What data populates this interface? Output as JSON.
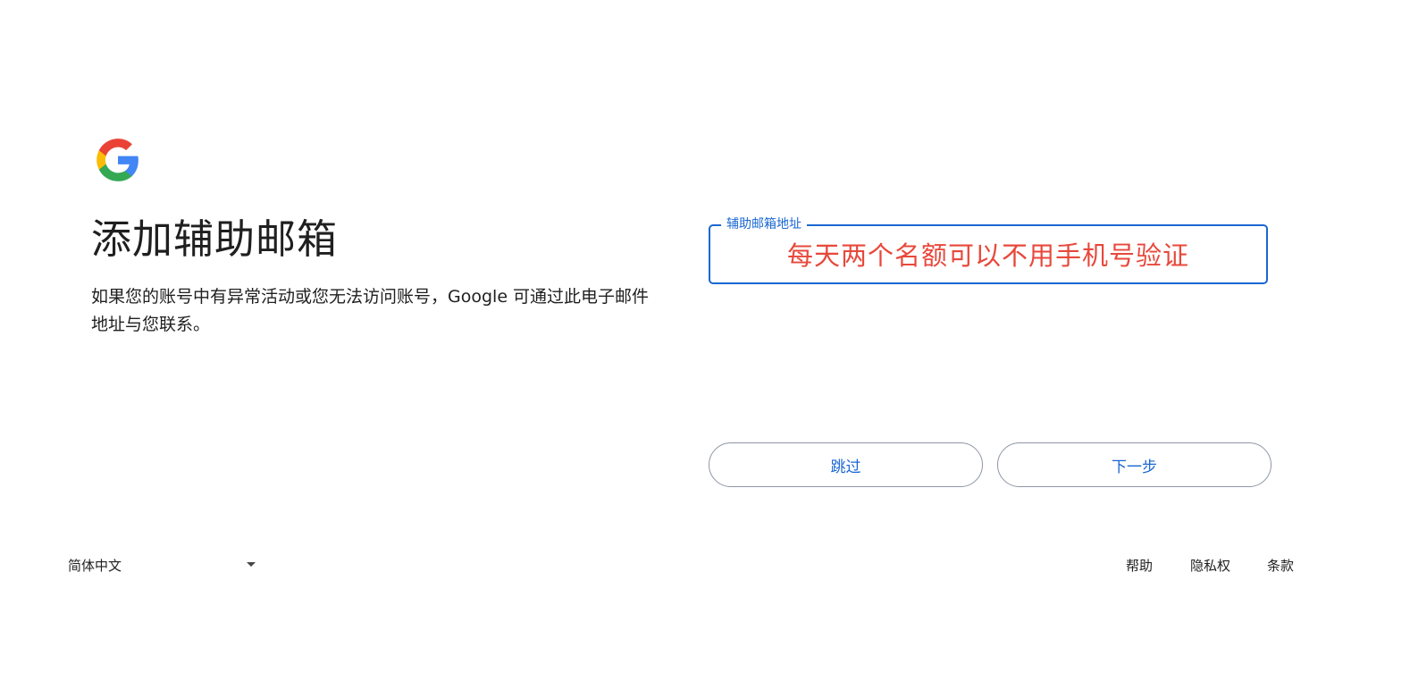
{
  "header": {
    "logo": "google-g-logo"
  },
  "main": {
    "title": "添加辅助邮箱",
    "description": "如果您的账号中有异常活动或您无法访问账号，Google 可通过此电子邮件地址与您联系。"
  },
  "form": {
    "email_label": "辅助邮箱地址",
    "email_value": "每天两个名额可以不用手机号验证"
  },
  "actions": {
    "skip_label": "跳过",
    "next_label": "下一步"
  },
  "footer": {
    "language": "简体中文",
    "help": "帮助",
    "privacy": "隐私权",
    "terms": "条款"
  },
  "colors": {
    "accent": "#1a67d2",
    "annotation_text": "#e8483b",
    "button_border": "#8f96a3"
  }
}
